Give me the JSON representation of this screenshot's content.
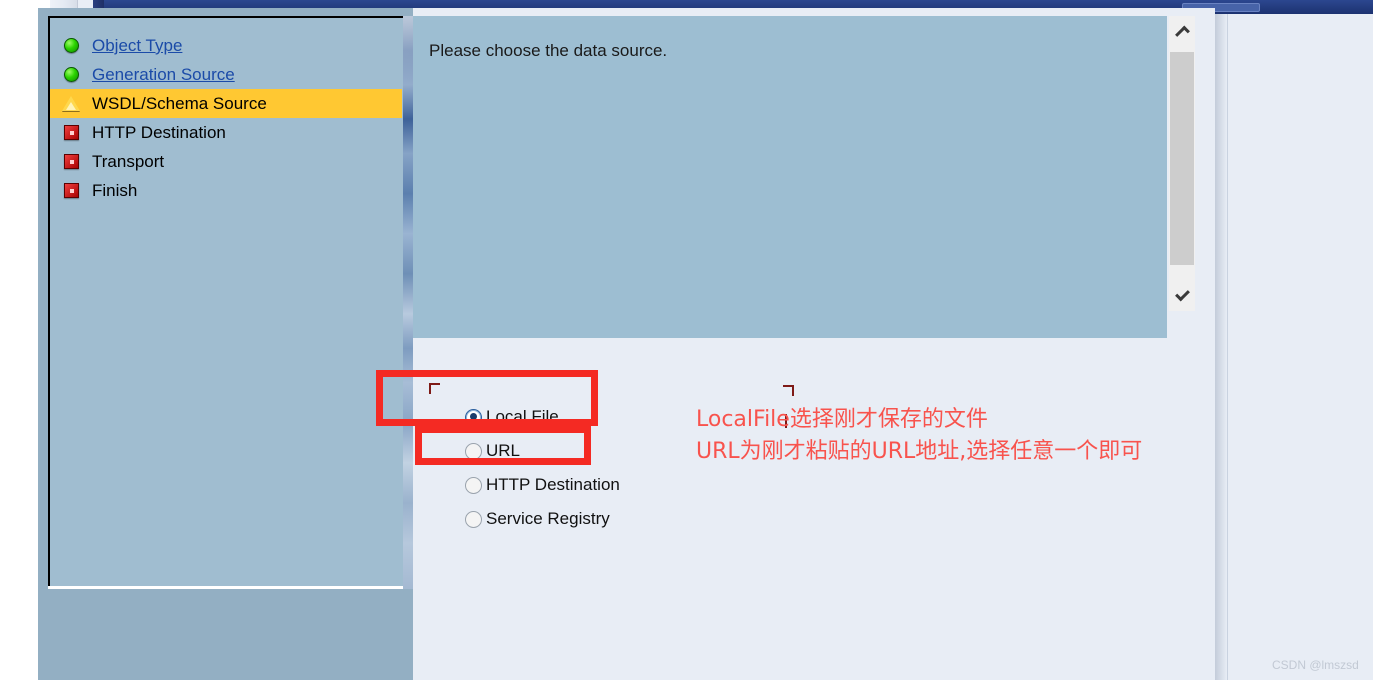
{
  "wizard": {
    "nav_items": [
      {
        "label": "Object Type",
        "icon": "green-status-icon",
        "state": "link",
        "current": false
      },
      {
        "label": "Generation Source",
        "icon": "green-status-icon",
        "state": "link",
        "current": false
      },
      {
        "label": "WSDL/Schema Source",
        "icon": "warning-status-icon",
        "state": "current",
        "current": true
      },
      {
        "label": "HTTP Destination",
        "icon": "red-status-icon",
        "state": "pending",
        "current": false
      },
      {
        "label": "Transport",
        "icon": "red-status-icon",
        "state": "pending",
        "current": false
      },
      {
        "label": "Finish",
        "icon": "red-status-icon",
        "state": "pending",
        "current": false
      }
    ],
    "message": "Please choose the data source.",
    "radio_options": [
      {
        "label": "Local File",
        "checked": true
      },
      {
        "label": "URL",
        "checked": false
      },
      {
        "label": "HTTP Destination",
        "checked": false
      },
      {
        "label": "Service Registry",
        "checked": false
      }
    ]
  },
  "annotation": {
    "line1": "LocalFile选择刚才保存的文件",
    "line2": "URL为刚才粘贴的URL地址,选择任意一个即可",
    "color": "#f8534d",
    "box_color": "#f42a23"
  },
  "scrollbar": {
    "up_arrow": "chevron-up-icon",
    "down_arrow": "chevron-down-icon"
  },
  "watermark": {
    "text": "CSDN @lmszsd"
  },
  "colors": {
    "highlight": "#ffc832",
    "link": "#1b4ba8",
    "message_panel": "#9dbed2",
    "content_panel": "#e8edf5",
    "nav_panel": "#a0bdd0",
    "dialog_bg": "#93afc3"
  }
}
